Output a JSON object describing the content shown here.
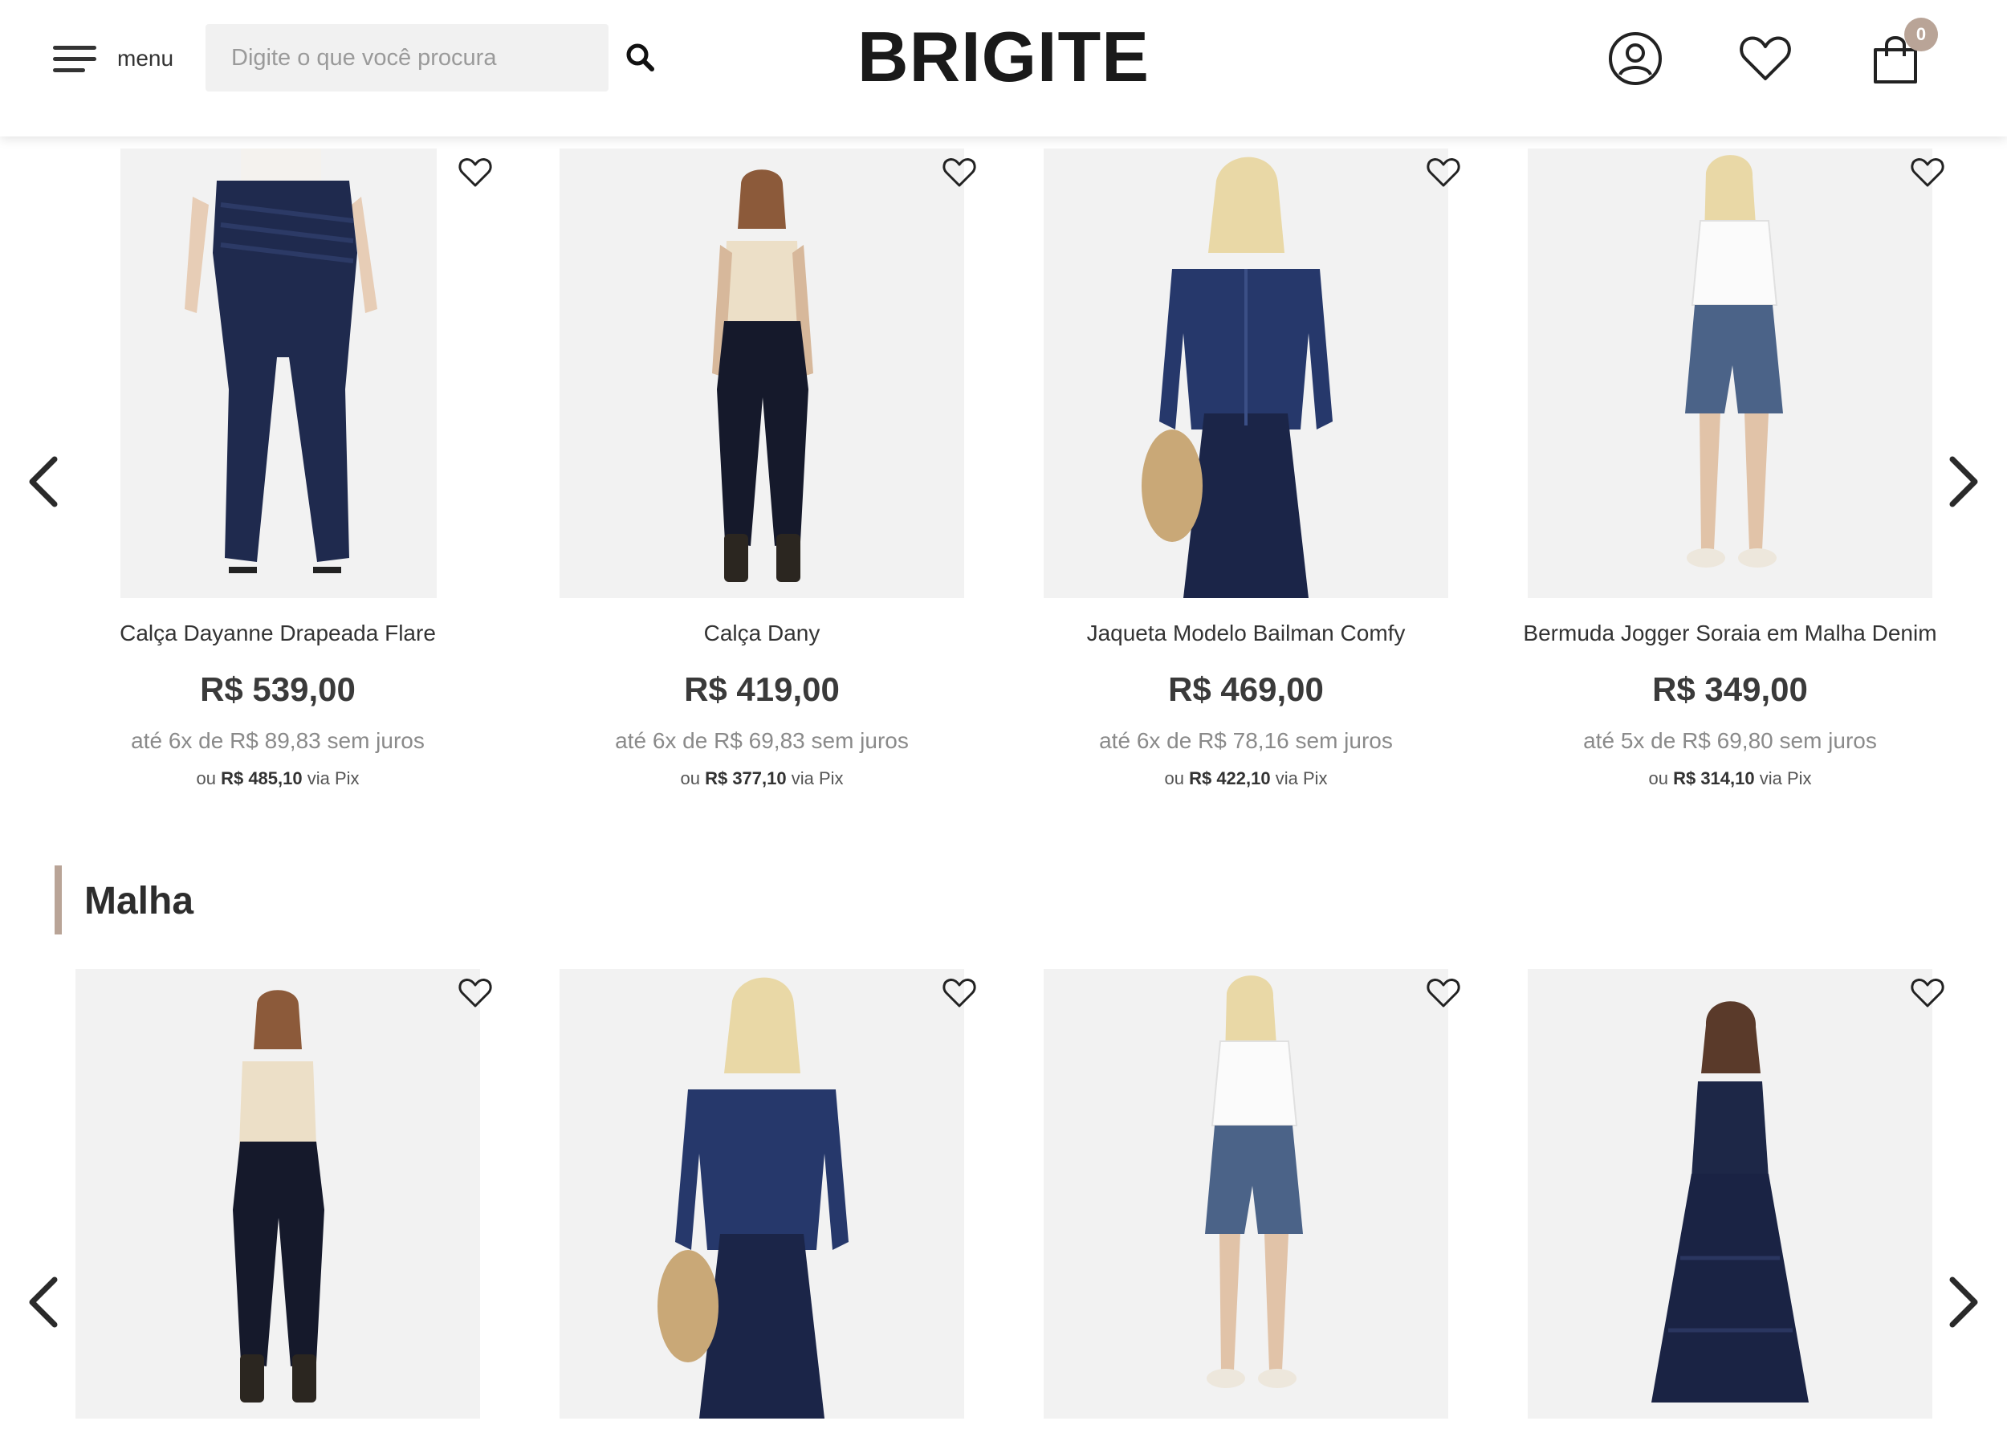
{
  "header": {
    "menu_label": "menu",
    "search_placeholder": "Digite o que você procura",
    "logo": "BRIGITE",
    "cart_count": "0"
  },
  "icons": {
    "menu": "hamburger-icon",
    "search": "search-icon",
    "account": "user-icon",
    "wishlist": "heart-icon",
    "cart": "shopping-bag-icon",
    "prev": "chevron-left-icon",
    "next": "chevron-right-icon"
  },
  "colors": {
    "accent": "#b9a497",
    "text": "#333333",
    "muted": "#8a8a8a",
    "image_bg": "#f2f2f2",
    "denim": "#1e2a4a"
  },
  "carousel_top": {
    "products": [
      {
        "name": "Calça Dayanne Drapeada Flare",
        "price": "R$ 539,00",
        "installments": "até 6x de R$ 89,83 sem juros",
        "pix_prefix": "ou",
        "pix_price": "R$ 485,10",
        "pix_suffix": "via Pix"
      },
      {
        "name": "Calça Dany",
        "price": "R$ 419,00",
        "installments": "até 6x de R$ 69,83 sem juros",
        "pix_prefix": "ou",
        "pix_price": "R$ 377,10",
        "pix_suffix": "via Pix"
      },
      {
        "name": "Jaqueta Modelo Bailman Comfy",
        "price": "R$ 469,00",
        "installments": "até 6x de R$ 78,16 sem juros",
        "pix_prefix": "ou",
        "pix_price": "R$ 422,10",
        "pix_suffix": "via Pix"
      },
      {
        "name": "Bermuda Jogger Soraia em Malha Denim",
        "price": "R$ 349,00",
        "installments": "até 5x de R$ 69,80 sem juros",
        "pix_prefix": "ou",
        "pix_price": "R$ 314,10",
        "pix_suffix": "via Pix"
      }
    ]
  },
  "section_malha": {
    "title": "Malha"
  }
}
